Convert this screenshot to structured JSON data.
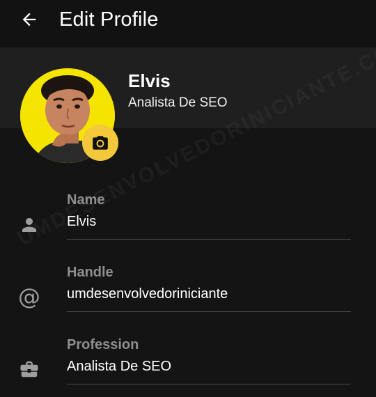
{
  "appbar": {
    "title": "Edit Profile",
    "back_icon": "arrow-left-icon"
  },
  "profile": {
    "name": "Elvis",
    "profession": "Analista De SEO",
    "avatar_bg": "#f4e400",
    "camera_icon": "camera-icon",
    "camera_bg": "#f3c93b"
  },
  "fields": [
    {
      "icon": "person-icon",
      "label": "Name",
      "value": "Elvis"
    },
    {
      "icon": "at-sign-icon",
      "label": "Handle",
      "value": "umdesenvolvedoriniciante"
    },
    {
      "icon": "briefcase-icon",
      "label": "Profession",
      "value": "Analista De SEO"
    }
  ],
  "watermark": "UMDESENVOLVEDORINICIANTE.COM",
  "colors": {
    "background": "#141414",
    "header_band": "#1f1f1f",
    "label": "#8f8f8f",
    "icon": "#9e9e9e",
    "divider": "#4a4a4a"
  }
}
